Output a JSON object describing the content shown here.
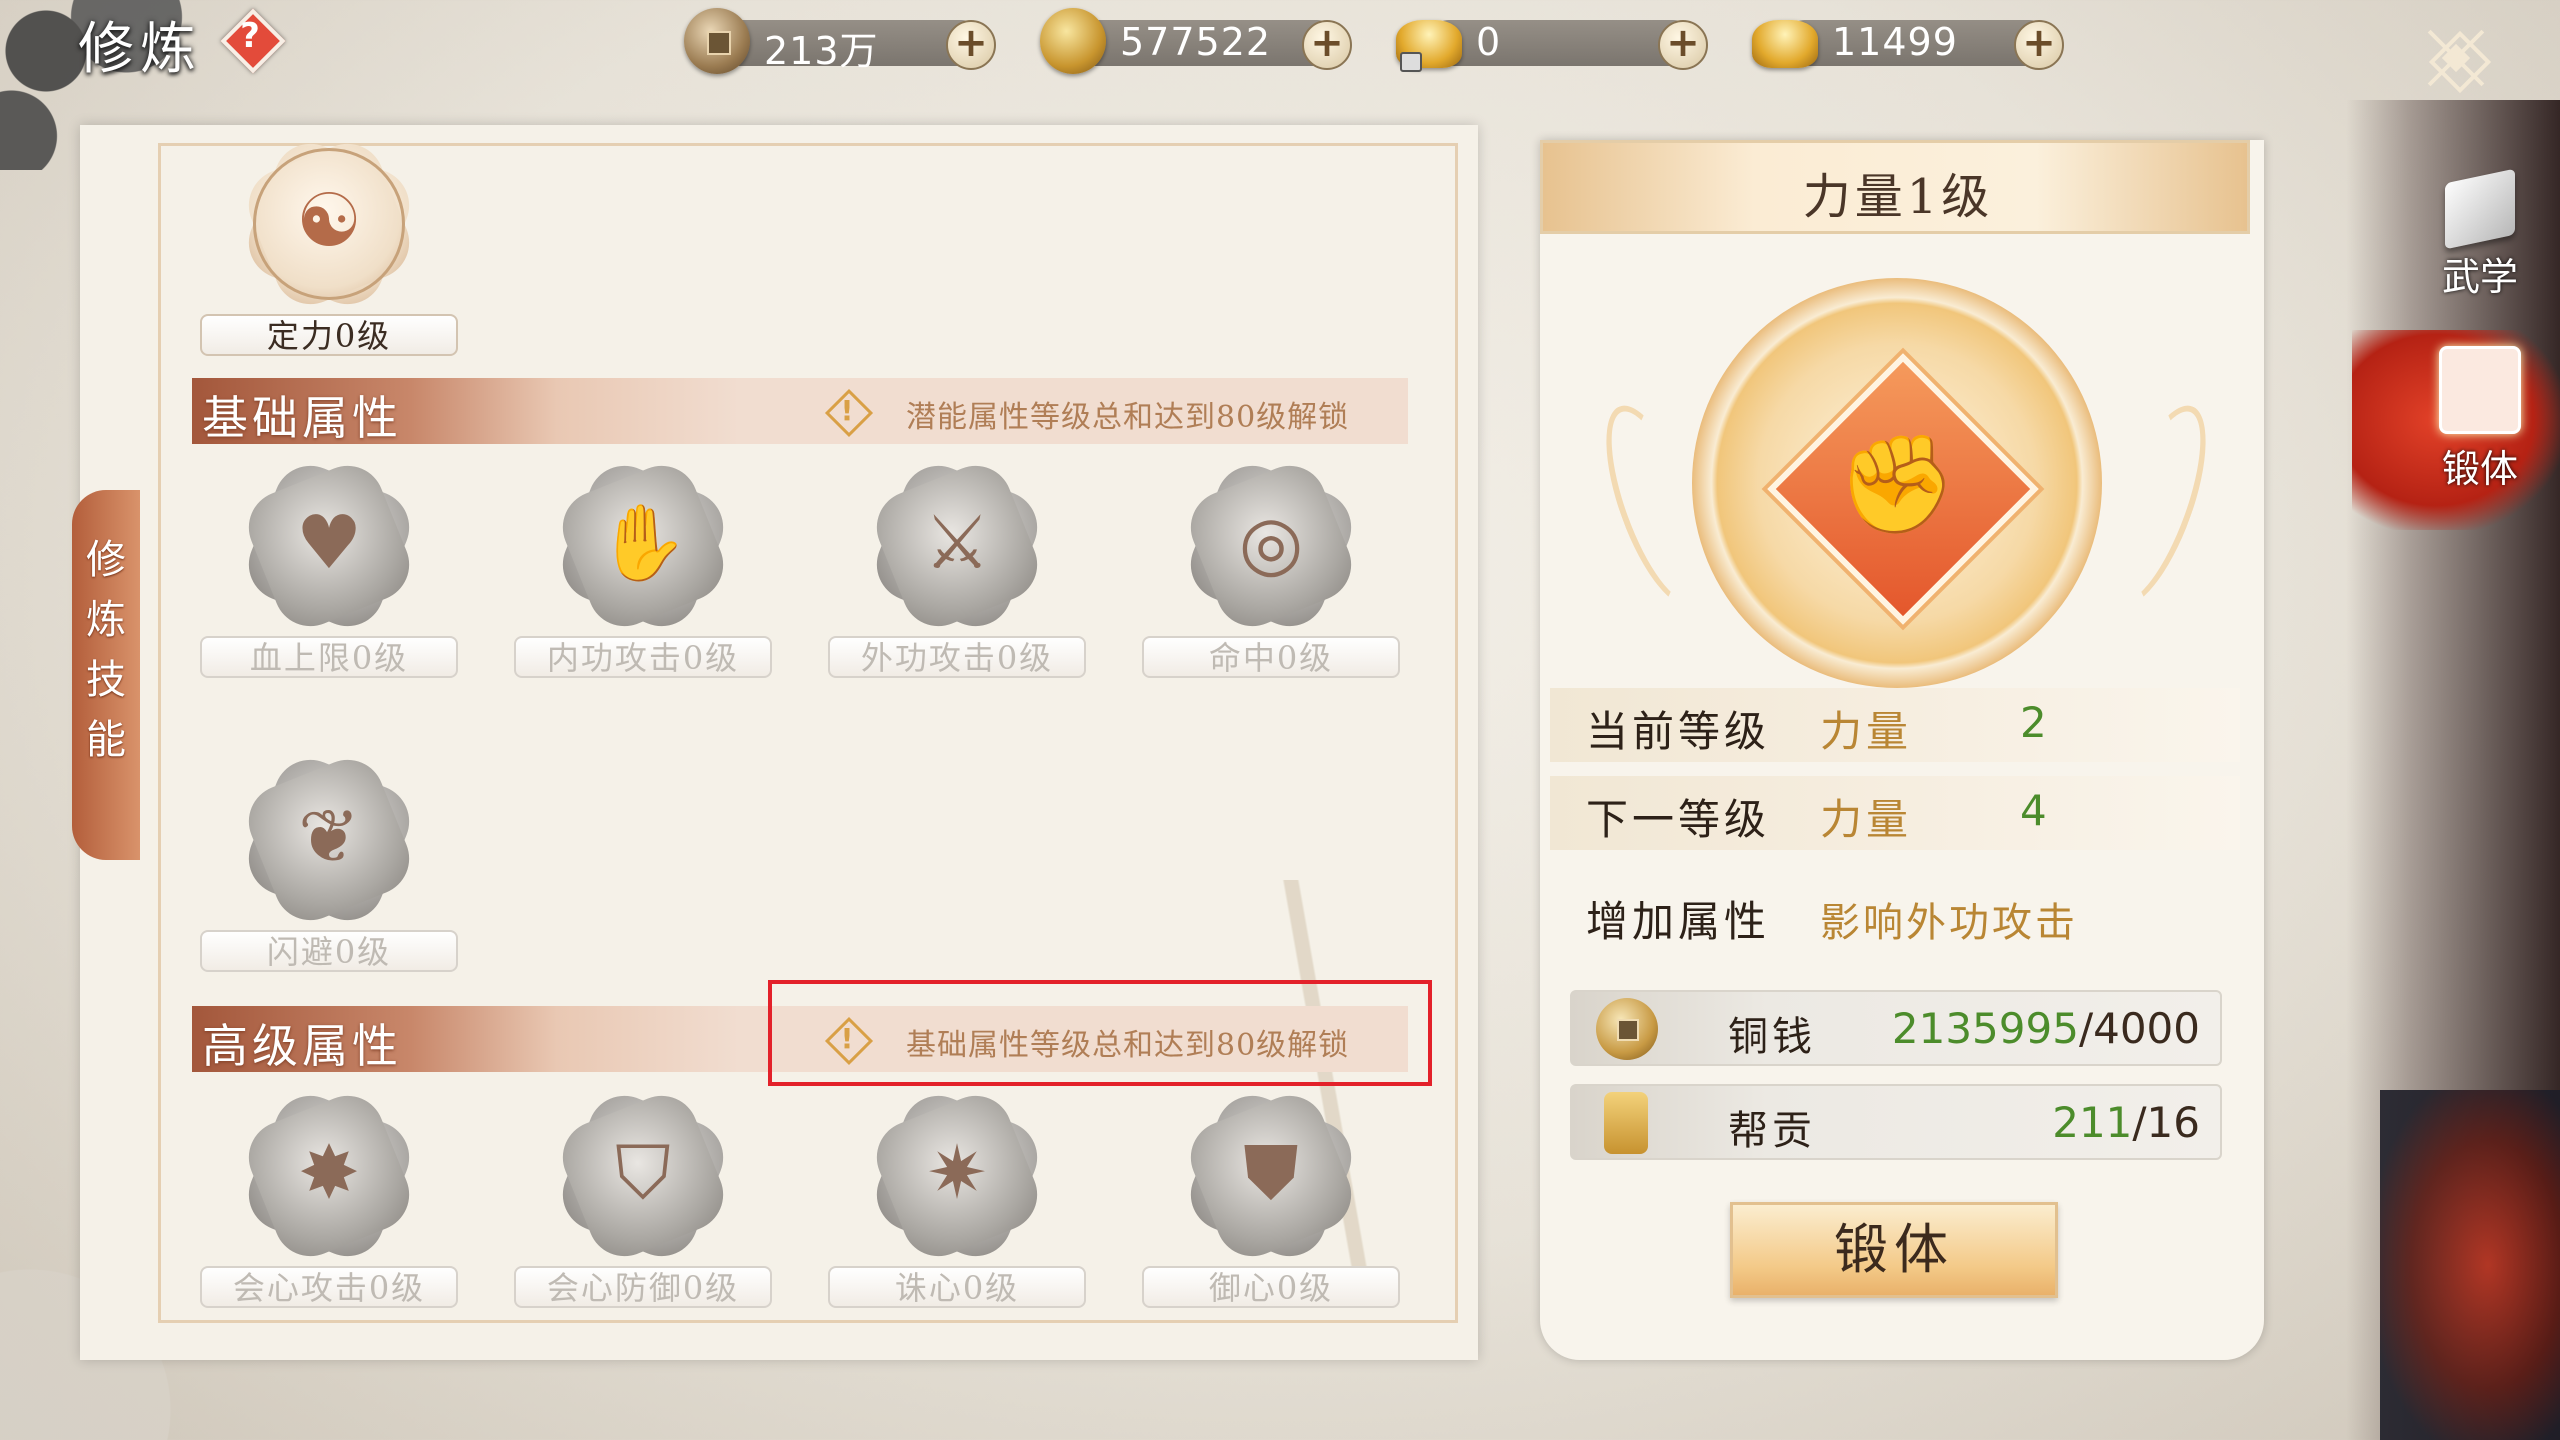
{
  "title": "修炼",
  "help": "?",
  "currencies": [
    {
      "id": "copper",
      "icon": "copper-coin-icon",
      "value": "213万"
    },
    {
      "id": "gold",
      "icon": "gold-coin-icon",
      "value": "577522"
    },
    {
      "id": "bound-ingot",
      "icon": "bound-gold-ingot-icon",
      "value": "0"
    },
    {
      "id": "ingot",
      "icon": "gold-ingot-icon",
      "value": "11499"
    }
  ],
  "plus": "+",
  "side_nav": [
    {
      "label": "武学",
      "icon": "book-icon",
      "selected": false
    },
    {
      "label": "锻体",
      "icon": "scroll-icon",
      "selected": true
    }
  ],
  "left": {
    "vertical_tab": [
      "修",
      "炼",
      "技",
      "能"
    ],
    "top_skill": {
      "name": "定力0级",
      "icon": "meditation-icon",
      "unlocked": true
    },
    "basic": {
      "title": "基础属性",
      "lock_text": "潜能属性等级总和达到80级解锁",
      "skills": [
        {
          "name": "血上限0级",
          "icon": "heart-icon"
        },
        {
          "name": "内功攻击0级",
          "icon": "palm-icon"
        },
        {
          "name": "外功攻击0级",
          "icon": "sword-icon"
        },
        {
          "name": "命中0级",
          "icon": "target-icon"
        },
        {
          "name": "闪避0级",
          "icon": "boot-icon"
        }
      ]
    },
    "advanced": {
      "title": "高级属性",
      "lock_text": "基础属性等级总和达到80级解锁",
      "skills": [
        {
          "name": "会心攻击0级",
          "icon": "burst-icon"
        },
        {
          "name": "会心防御0级",
          "icon": "shield-burst-icon"
        },
        {
          "name": "诛心0级",
          "icon": "blade-burst-icon"
        },
        {
          "name": "御心0级",
          "icon": "shield-crack-icon"
        }
      ]
    }
  },
  "right": {
    "header": "力量1级",
    "emblem_icon": "fist-icon",
    "current": {
      "label": "当前等级",
      "attr": "力量",
      "value": "2"
    },
    "next": {
      "label": "下一等级",
      "attr": "力量",
      "value": "4"
    },
    "effect": {
      "label": "增加属性",
      "value": "影响外功攻击"
    },
    "costs": [
      {
        "name": "铜钱",
        "icon": "copper-coin-icon",
        "have": "2135995",
        "need": "/4000"
      },
      {
        "name": "帮贡",
        "icon": "guild-token-icon",
        "have": "211",
        "need": "/16"
      }
    ],
    "button": "锻体"
  },
  "colors": {
    "accent": "#b35e3b",
    "green": "#4c8c2b",
    "gold": "#b98634",
    "highlight": "#e3212a"
  }
}
